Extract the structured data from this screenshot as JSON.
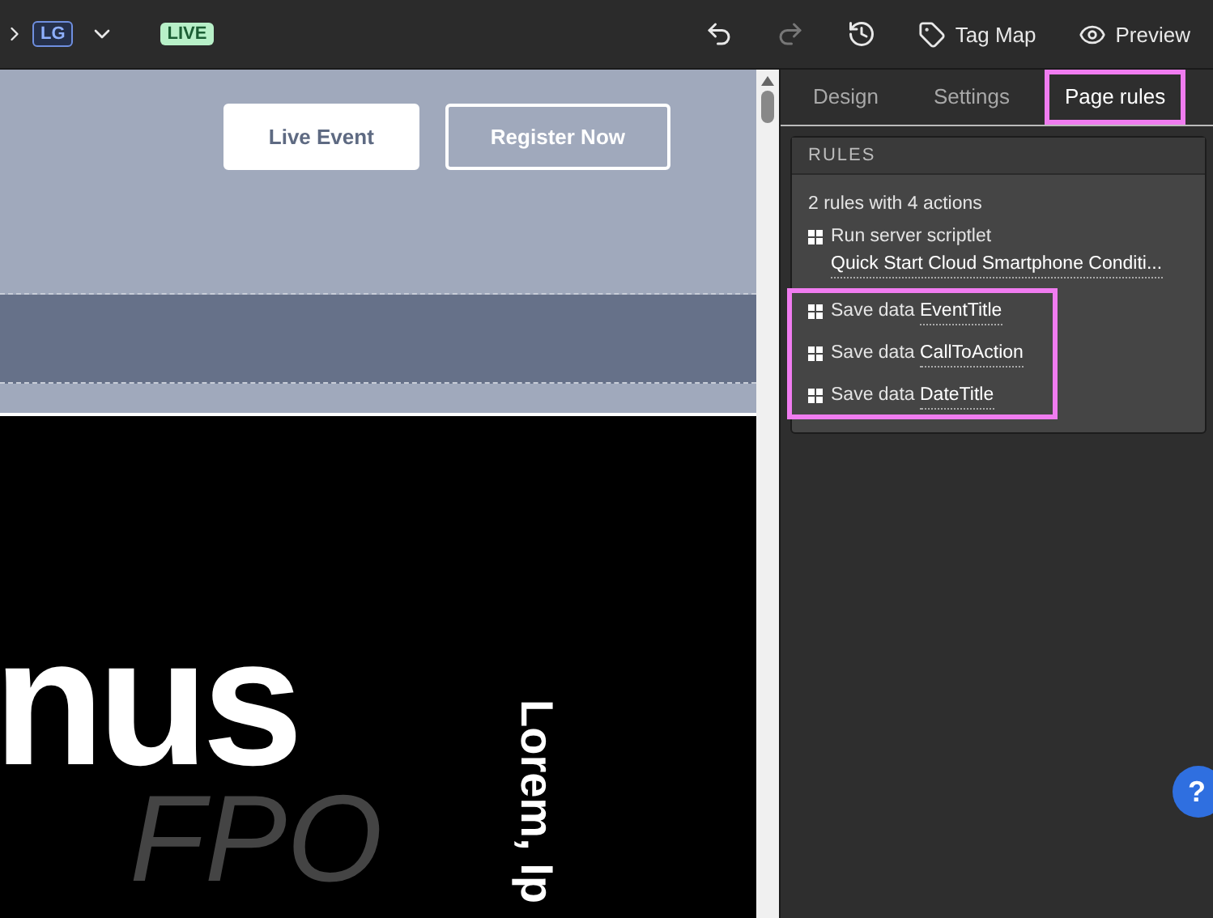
{
  "toolbar": {
    "breakpoint": "LG",
    "status": "LIVE",
    "undo": {
      "disabled": false
    },
    "redo": {
      "disabled": true
    },
    "tag_map": "Tag Map",
    "preview": "Preview"
  },
  "canvas": {
    "buttons": [
      {
        "label": "Live Event",
        "kind": "solid"
      },
      {
        "label": "Register Now",
        "kind": "outline"
      }
    ],
    "headline": [
      "nus"
    ],
    "watermark": "FPO",
    "vertical_text": "Lorem, Ip"
  },
  "panel": {
    "tabs": [
      {
        "label": "Design",
        "selected": false,
        "highlighted": false
      },
      {
        "label": "Settings",
        "selected": false,
        "highlighted": false
      },
      {
        "label": "Page rules",
        "selected": true,
        "highlighted": true
      }
    ],
    "rules": {
      "header": "RULES",
      "summary": "2 rules with 4 actions",
      "actions": [
        {
          "verb": "Run server scriptlet",
          "target": "Quick Start Cloud Smartphone Conditi...",
          "highlighted": false
        },
        {
          "verb": "Save data",
          "target": "EventTitle",
          "highlighted": true
        },
        {
          "verb": "Save data",
          "target": "CallToAction",
          "highlighted": true
        },
        {
          "verb": "Save data",
          "target": "DateTitle",
          "highlighted": true
        }
      ]
    }
  },
  "help": "?"
}
